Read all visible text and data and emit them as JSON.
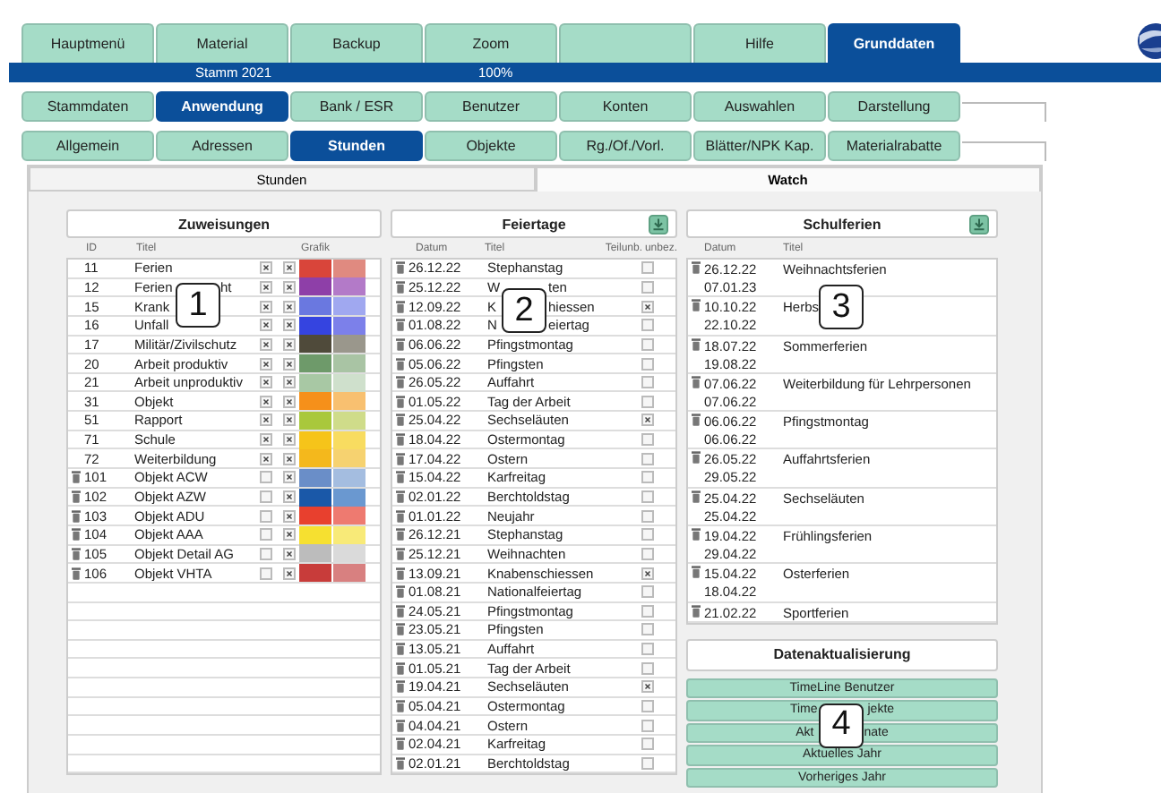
{
  "main_tabs": [
    {
      "label": "Hauptmenü",
      "selected": false
    },
    {
      "label": "Material",
      "selected": false
    },
    {
      "label": "Backup",
      "selected": false
    },
    {
      "label": "Zoom",
      "selected": false
    },
    {
      "selected": false
    },
    {
      "label": "Hilfe",
      "selected": false
    },
    {
      "label": "Grunddaten",
      "selected": true
    }
  ],
  "status_bar": {
    "items": [
      "Stamm 2021",
      "100%"
    ]
  },
  "sub_tabs": [
    {
      "label": "Stammdaten",
      "selected": false
    },
    {
      "label": "Anwendung",
      "selected": true
    },
    {
      "label": "Bank / ESR",
      "selected": false
    },
    {
      "label": "Benutzer",
      "selected": false
    },
    {
      "label": "Konten",
      "selected": false
    },
    {
      "label": "Auswahlen",
      "selected": false
    },
    {
      "label": "Darstellung",
      "selected": false
    }
  ],
  "section_tabs": [
    {
      "label": "Allgemein",
      "selected": false
    },
    {
      "label": "Adressen",
      "selected": false
    },
    {
      "label": "Stunden",
      "selected": true
    },
    {
      "label": "Objekte",
      "selected": false
    },
    {
      "label": "Rg./Of./Vorl.",
      "selected": false
    },
    {
      "label": "Blätter/NPK Kap.",
      "selected": false
    },
    {
      "label": "Materialrabatte",
      "selected": false
    }
  ],
  "view_tabs": [
    {
      "label": "Stunden",
      "selected": false
    },
    {
      "label": "Watch",
      "selected": true
    }
  ],
  "zuweisungen": {
    "title": "Zuweisungen",
    "marker": "1",
    "columns": [
      "ID",
      "Titel",
      "Grafik"
    ],
    "rows": [
      {
        "id": "11",
        "title": "Ferien",
        "deletable": false,
        "checked_1": true,
        "checked_2": true,
        "colors": [
          {
            "color": "#d9453a"
          },
          {
            "color": "#e08a80"
          }
        ]
      },
      {
        "id": "12",
        "title_parts": [
          "Ferien",
          "ht"
        ],
        "deletable": false,
        "checked_1": true,
        "checked_2": true,
        "colors": [
          {
            "color": "#8e3fa8"
          },
          {
            "color": "#b37ac8"
          }
        ]
      },
      {
        "id": "15",
        "title": "Krank",
        "deletable": false,
        "checked_1": true,
        "checked_2": true,
        "colors": [
          {
            "color": "#6a78e0"
          },
          {
            "color": "#a0a8f0"
          }
        ]
      },
      {
        "id": "16",
        "title": "Unfall",
        "deletable": false,
        "checked_1": true,
        "checked_2": true,
        "colors": [
          {
            "color": "#3544e0"
          },
          {
            "color": "#7c80ea"
          }
        ]
      },
      {
        "id": "17",
        "title": "Militär/Zivilschutz",
        "deletable": false,
        "checked_1": true,
        "checked_2": true,
        "colors": [
          {
            "color": "#4f4a3a"
          },
          {
            "color": "#9a978c"
          }
        ]
      },
      {
        "id": "20",
        "title": "Arbeit produktiv",
        "deletable": false,
        "checked_1": true,
        "checked_2": true,
        "colors": [
          {
            "color": "#6e9a6a"
          },
          {
            "color": "#a9c4a4"
          }
        ]
      },
      {
        "id": "21",
        "title": "Arbeit unproduktiv",
        "deletable": false,
        "checked_1": true,
        "checked_2": true,
        "colors": [
          {
            "color": "#a8c8a4"
          },
          {
            "color": "#cfe0cc"
          }
        ]
      },
      {
        "id": "31",
        "title": "Objekt",
        "deletable": false,
        "checked_1": true,
        "checked_2": true,
        "colors": [
          {
            "color": "#f6901a"
          },
          {
            "color": "#f8c070"
          }
        ]
      },
      {
        "id": "51",
        "title": "Rapport",
        "deletable": false,
        "checked_1": true,
        "checked_2": true,
        "colors": [
          {
            "color": "#a9c83c"
          },
          {
            "color": "#cfdc8a"
          }
        ]
      },
      {
        "id": "71",
        "title": "Schule",
        "deletable": false,
        "checked_1": true,
        "checked_2": true,
        "colors": [
          {
            "color": "#f6c41a"
          },
          {
            "color": "#f8dc60"
          }
        ]
      },
      {
        "id": "72",
        "title": "Weiterbildung",
        "deletable": false,
        "checked_1": true,
        "checked_2": true,
        "colors": [
          {
            "color": "#f4b81c"
          },
          {
            "color": "#f6d270"
          }
        ]
      },
      {
        "id": "101",
        "title": "Objekt ACW",
        "deletable": true,
        "checked_1": false,
        "checked_2": true,
        "colors": [
          {
            "color": "#6a8ec8"
          },
          {
            "color": "#a4bde0"
          }
        ]
      },
      {
        "id": "102",
        "title": "Objekt AZW",
        "deletable": true,
        "checked_1": false,
        "checked_2": true,
        "colors": [
          {
            "color": "#1a58a8"
          },
          {
            "color": "#6a98d0"
          }
        ]
      },
      {
        "id": "103",
        "title": "Objekt ADU",
        "deletable": true,
        "checked_1": false,
        "checked_2": true,
        "colors": [
          {
            "color": "#e8402e"
          },
          {
            "color": "#ee7a70"
          }
        ]
      },
      {
        "id": "104",
        "title": "Objekt AAA",
        "deletable": true,
        "checked_1": false,
        "checked_2": true,
        "colors": [
          {
            "color": "#f6e030"
          },
          {
            "color": "#f8ea78"
          }
        ]
      },
      {
        "id": "105",
        "title": "Objekt Detail AG",
        "deletable": true,
        "checked_1": false,
        "checked_2": true,
        "colors": [
          {
            "color": "#bcbcbc"
          },
          {
            "color": "#dadada"
          }
        ]
      },
      {
        "id": "106",
        "title": "Objekt VHTA",
        "deletable": true,
        "checked_1": false,
        "checked_2": true,
        "colors": [
          {
            "color": "#c83c3a"
          },
          {
            "color": "#d88080"
          }
        ]
      }
    ]
  },
  "feiertage": {
    "title": "Feiertage",
    "marker": "2",
    "columns": [
      "Datum",
      "Titel",
      "Teilunb.",
      "unbez."
    ],
    "rows": [
      {
        "date": "26.12.22",
        "title": "Stephanstag",
        "unpaid": false
      },
      {
        "date": "25.12.22",
        "title_parts": [
          "W",
          "ten"
        ],
        "unpaid": false
      },
      {
        "date": "12.09.22",
        "title_parts": [
          "K",
          "hiessen"
        ],
        "unpaid": true
      },
      {
        "date": "01.08.22",
        "title_parts": [
          "N",
          "eiertag"
        ],
        "unpaid": false
      },
      {
        "date": "06.06.22",
        "title": "Pfingstmontag",
        "unpaid": false
      },
      {
        "date": "05.06.22",
        "title": "Pfingsten",
        "unpaid": false
      },
      {
        "date": "26.05.22",
        "title": "Auffahrt",
        "unpaid": false
      },
      {
        "date": "01.05.22",
        "title": "Tag der Arbeit",
        "unpaid": false
      },
      {
        "date": "25.04.22",
        "title": "Sechseläuten",
        "unpaid": true
      },
      {
        "date": "18.04.22",
        "title": "Ostermontag",
        "unpaid": false
      },
      {
        "date": "17.04.22",
        "title": "Ostern",
        "unpaid": false
      },
      {
        "date": "15.04.22",
        "title": "Karfreitag",
        "unpaid": false
      },
      {
        "date": "02.01.22",
        "title": "Berchtoldstag",
        "unpaid": false
      },
      {
        "date": "01.01.22",
        "title": "Neujahr",
        "unpaid": false
      },
      {
        "date": "26.12.21",
        "title": "Stephanstag",
        "unpaid": false
      },
      {
        "date": "25.12.21",
        "title": "Weihnachten",
        "unpaid": false
      },
      {
        "date": "13.09.21",
        "title": "Knabenschiessen",
        "unpaid": true
      },
      {
        "date": "01.08.21",
        "title": "Nationalfeiertag",
        "unpaid": false
      },
      {
        "date": "24.05.21",
        "title": "Pfingstmontag",
        "unpaid": false
      },
      {
        "date": "23.05.21",
        "title": "Pfingsten",
        "unpaid": false
      },
      {
        "date": "13.05.21",
        "title": "Auffahrt",
        "unpaid": false
      },
      {
        "date": "01.05.21",
        "title": "Tag der Arbeit",
        "unpaid": false
      },
      {
        "date": "19.04.21",
        "title": "Sechseläuten",
        "unpaid": true
      },
      {
        "date": "05.04.21",
        "title": "Ostermontag",
        "unpaid": false
      },
      {
        "date": "04.04.21",
        "title": "Ostern",
        "unpaid": false
      },
      {
        "date": "02.04.21",
        "title": "Karfreitag",
        "unpaid": false
      },
      {
        "date": "02.01.21",
        "title": "Berchtoldstag",
        "unpaid": false
      }
    ]
  },
  "schulferien": {
    "title": "Schulferien",
    "marker": "3",
    "columns": [
      "Datum",
      "Titel"
    ],
    "rows": [
      {
        "from": "26.12.22",
        "to": "07.01.23",
        "title": "Weihnachtsferien"
      },
      {
        "from": "10.10.22",
        "to": "22.10.22",
        "title": "Herbs"
      },
      {
        "from": "18.07.22",
        "to": "19.08.22",
        "title": "Sommerferien"
      },
      {
        "from": "07.06.22",
        "to": "07.06.22",
        "title": "Weiterbildung für Lehrpersonen"
      },
      {
        "from": "06.06.22",
        "to": "06.06.22",
        "title": "Pfingstmontag"
      },
      {
        "from": "26.05.22",
        "to": "29.05.22",
        "title": "Auffahrtsferien"
      },
      {
        "from": "25.04.22",
        "to": "25.04.22",
        "title": "Sechseläuten"
      },
      {
        "from": "19.04.22",
        "to": "29.04.22",
        "title": "Frühlingsferien"
      },
      {
        "from": "15.04.22",
        "to": "18.04.22",
        "title": "Osterferien"
      },
      {
        "from": "21.02.22",
        "title": "Sportferien"
      }
    ]
  },
  "datenaktualisierung": {
    "title": "Datenaktualisierung",
    "marker": "4",
    "buttons": [
      {
        "label": "TimeLine Benutzer"
      },
      {
        "label_parts": [
          "Time",
          "jekte"
        ]
      },
      {
        "label_parts": [
          "Akt",
          "nate"
        ]
      },
      {
        "label": "Aktuelles Jahr"
      },
      {
        "label": "Vorheriges Jahr"
      }
    ]
  }
}
